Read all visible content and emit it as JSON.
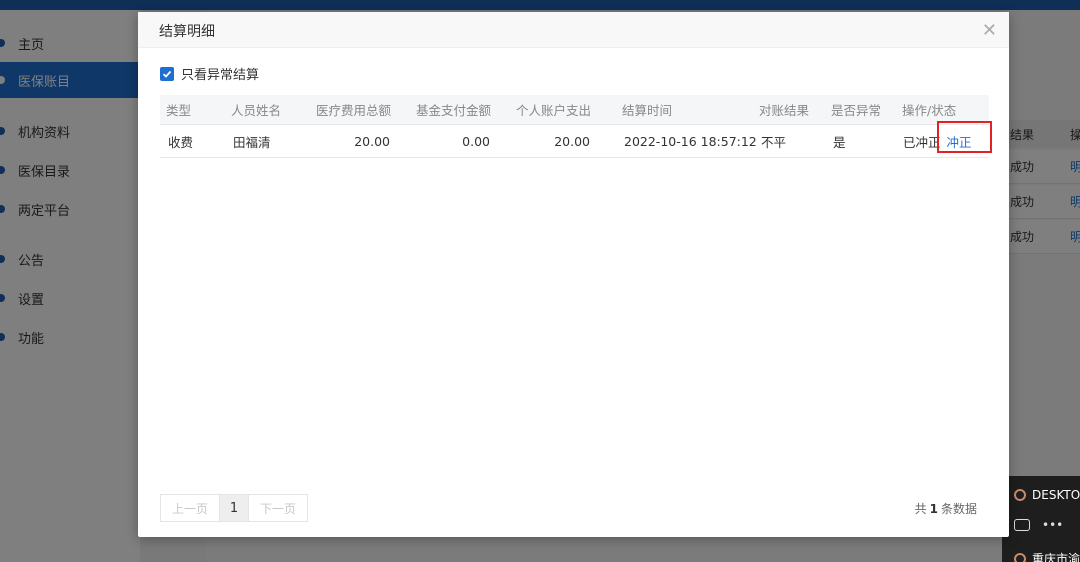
{
  "sidebar": {
    "items": [
      {
        "label": "主页"
      },
      {
        "label": "医保账目"
      },
      {
        "label": "机构资料"
      },
      {
        "label": "医保目录"
      },
      {
        "label": "两定平台"
      },
      {
        "label": "公告"
      },
      {
        "label": "设置"
      },
      {
        "label": "功能"
      }
    ]
  },
  "background_table": {
    "header": "结果",
    "header_link": "操",
    "rows": [
      {
        "status": "成功",
        "link": "明"
      },
      {
        "status": "成功",
        "link": "明"
      },
      {
        "status": "成功",
        "link": "明"
      }
    ]
  },
  "desktop_popup": {
    "title": "DESKTO",
    "location": "重庆市渝"
  },
  "modal": {
    "title": "结算明细",
    "filter_label": "只看异常结算",
    "filter_checked": true,
    "columns": [
      "类型",
      "人员姓名",
      "医疗费用总额",
      "基金支付金额",
      "个人账户支出",
      "结算时间",
      "对账结果",
      "是否异常",
      "操作/状态"
    ],
    "rows": [
      {
        "type": "收费",
        "name": "田福清",
        "total": "20.00",
        "fund": "0.00",
        "personal": "20.00",
        "time": "2022-10-16 18:57:12",
        "reconcile": "不平",
        "abnormal": "是",
        "status": "已冲正",
        "action": "冲正"
      }
    ],
    "pager": {
      "prev": "上一页",
      "current": "1",
      "next": "下一页",
      "total_prefix": "共",
      "total_count": "1",
      "total_suffix": "条数据"
    }
  },
  "colors": {
    "accent": "#1f6fd1",
    "highlight_border": "#e02424",
    "topbar": "#1f5fae"
  }
}
